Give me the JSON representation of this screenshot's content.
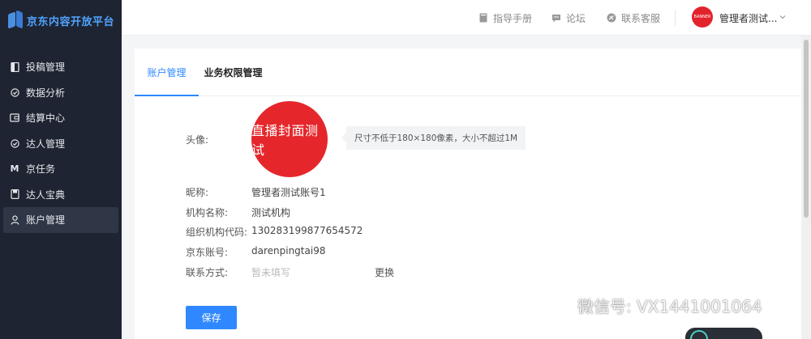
{
  "app": {
    "logo_text": "京东内容开放平台"
  },
  "sidebar": {
    "items": [
      {
        "label": "投稿管理",
        "icon": "document-icon"
      },
      {
        "label": "数据分析",
        "icon": "target-icon"
      },
      {
        "label": "结算中心",
        "icon": "wallet-icon"
      },
      {
        "label": "达人管理",
        "icon": "target-icon"
      },
      {
        "label": "京任务",
        "icon": "m-letter-icon"
      },
      {
        "label": "达人宝典",
        "icon": "book-icon"
      },
      {
        "label": "账户管理",
        "icon": "user-icon",
        "active": true
      }
    ]
  },
  "header": {
    "manual_label": "指导手册",
    "forum_label": "论坛",
    "support_label": "联系客服",
    "avatar_text": "BANNER",
    "user_name": "管理者测试..."
  },
  "tabs": [
    {
      "label": "账户管理",
      "active": true
    },
    {
      "label": "业务权限管理",
      "active": false
    }
  ],
  "profile": {
    "avatar_label": "头像:",
    "avatar_text": "直播封面测试",
    "avatar_tip": "尺寸不低于180×180像素，大小不超过1M",
    "nickname_label": "昵称:",
    "nickname_value": "管理者测试账号1",
    "org_name_label": "机构名称:",
    "org_name_value": "测试机构",
    "org_code_label": "组织机构代码:",
    "org_code_value": "130283199877654572",
    "jd_account_label": "京东账号:",
    "jd_account_value": "darenpingtai98",
    "contact_label": "联系方式:",
    "contact_placeholder": "暂未填写",
    "change_label": "更换",
    "save_label": "保存"
  },
  "watermark": {
    "text": "微信号: VX1441001064"
  },
  "colors": {
    "primary": "#2f88ff",
    "sidebar_bg": "#1e2431",
    "avatar_red": "#e5272b"
  }
}
